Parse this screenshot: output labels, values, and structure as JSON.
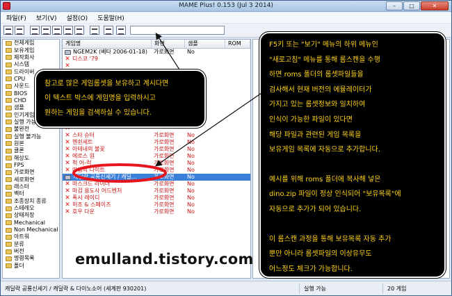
{
  "window": {
    "title": "MAME Plus! 0.153 (Jul  3 2014)"
  },
  "menu": [
    "파일(F)",
    "보기(V)",
    "설정(O)",
    "도움말(H)"
  ],
  "tree": [
    "전체게임",
    "보유게임",
    "제작회사",
    "시스템",
    "드라이버",
    "CPU",
    "사운드",
    "BIOS",
    "CHD",
    "샘플",
    "인기게임",
    "실행 가능",
    "불완전",
    "실행 불가능",
    "원본",
    "클론",
    "해상도",
    "FPS",
    "가로화면",
    "세로화면",
    "래스터",
    "벡터",
    "조종장치 종류",
    "스테레오",
    "상태저장",
    "Mechanical",
    "Non Mechanical",
    "아트워",
    "분류",
    "버전",
    "명령목록",
    "폴더"
  ],
  "list": {
    "headers": [
      "게임명",
      "화면",
      "샘플",
      "ROM"
    ],
    "rows": [
      {
        "name": "NGEM2K (베타 2006-01-18)",
        "screen": "가로화면",
        "samples": "No",
        "status": "ok"
      },
      {
        "name": "디스코 '79",
        "screen": "",
        "samples": "",
        "status": "x"
      },
      {
        "name": "",
        "screen": "",
        "samples": "",
        "status": "x"
      },
      {
        "name": "",
        "screen": "",
        "samples": "",
        "status": "x"
      },
      {
        "name": "",
        "screen": "",
        "samples": "",
        "status": "x"
      },
      {
        "name": "",
        "screen": "",
        "samples": "",
        "status": "x"
      },
      {
        "name": "",
        "screen": "",
        "samples": "",
        "status": "x"
      },
      {
        "name": "",
        "screen": "",
        "samples": "",
        "status": "x"
      },
      {
        "name": "",
        "screen": "",
        "samples": "",
        "status": "x"
      },
      {
        "name": "",
        "screen": "",
        "samples": "",
        "status": "x"
      },
      {
        "name": "",
        "screen": "",
        "samples": "",
        "status": "x"
      },
      {
        "name": "",
        "screen": "",
        "samples": "",
        "status": "x"
      },
      {
        "name": "스타 슈터",
        "screen": "가로화면",
        "samples": "No",
        "status": "x"
      },
      {
        "name": "헨쉰세트",
        "screen": "가로화면",
        "samples": "No",
        "status": "x"
      },
      {
        "name": "아테네의 불꽃",
        "screen": "가로화면",
        "samples": "No",
        "status": "x"
      },
      {
        "name": "에로스 원",
        "screen": "가로화면",
        "samples": "No",
        "status": "x"
      },
      {
        "name": "척 어-럭",
        "screen": "가로화면",
        "samples": "No",
        "status": "x"
      },
      {
        "name": "마법의 나이트",
        "screen": "가로화면",
        "samples": "No",
        "status": "x"
      },
      {
        "name": "캐딜락 공룡신세기 / 캐딜...",
        "screen": "가로화면",
        "samples": "No",
        "status": "sel"
      },
      {
        "name": "마스크드 라이더",
        "screen": "가로화면",
        "samples": "No",
        "status": "x"
      },
      {
        "name": "마검 용도사 어드벤처",
        "screen": "가로화면",
        "samples": "No",
        "status": "x"
      },
      {
        "name": "폭시 레이디",
        "screen": "가로화면",
        "samples": "No",
        "status": "x"
      },
      {
        "name": "허조 & 스페이즈",
        "screen": "가로화면",
        "samples": "No",
        "status": "x"
      },
      {
        "name": "호우 다운",
        "screen": "가로화면",
        "samples": "No",
        "status": "x"
      }
    ]
  },
  "callouts": {
    "left": [
      "참고로 많은 게임롬셋을 보유하고 계시다면",
      "이 텍스트 박스에 게임명을 입력하시고",
      "원하는 게임을 검색하실 수 있습니다."
    ],
    "right_a": [
      "F5키 또는 \"보기\" 메뉴의 하위 메뉴인",
      "\"새로고침\" 메뉴를 통해 롬스캔을 수행",
      "하면 roms 폴더의 롬셋파일들을",
      "검사해서 현재 버전의 에뮬레이터가",
      "가지고 있는 롬셋정보와 일치하여",
      "인식이 가능한 파일이 있다면",
      "해당 파일과 관련된 게임 목록을",
      "보유게임 목록에 자동으로 추가합니다."
    ],
    "right_b": [
      "예시를 위해 roms 폴더에 복사해 넣은",
      "dino.zip 파일이 정상 인식되어 \"보유목록\"에",
      "자동으로 추가가 되어 있습니다."
    ],
    "right_c": [
      "이 롬스캔 과정을 통해 보유목록 자동 추가",
      "뿐만 아니라 롬셋파일의 이상유무도",
      "어느정도 체크가 가능합니다."
    ]
  },
  "watermark": "emulland.tistory.com",
  "status": {
    "game": "캐딜락 공룡신세기 / 캐딜락 & 다이노소어 (세계판 930201)",
    "state": "실행 가능",
    "count": "20 게임"
  },
  "colors": {
    "callout_text": "#ffd21a",
    "highlight_ellipse": "#e5161d",
    "selection": "#3a7fd9",
    "missing_rom": "#c81414"
  }
}
